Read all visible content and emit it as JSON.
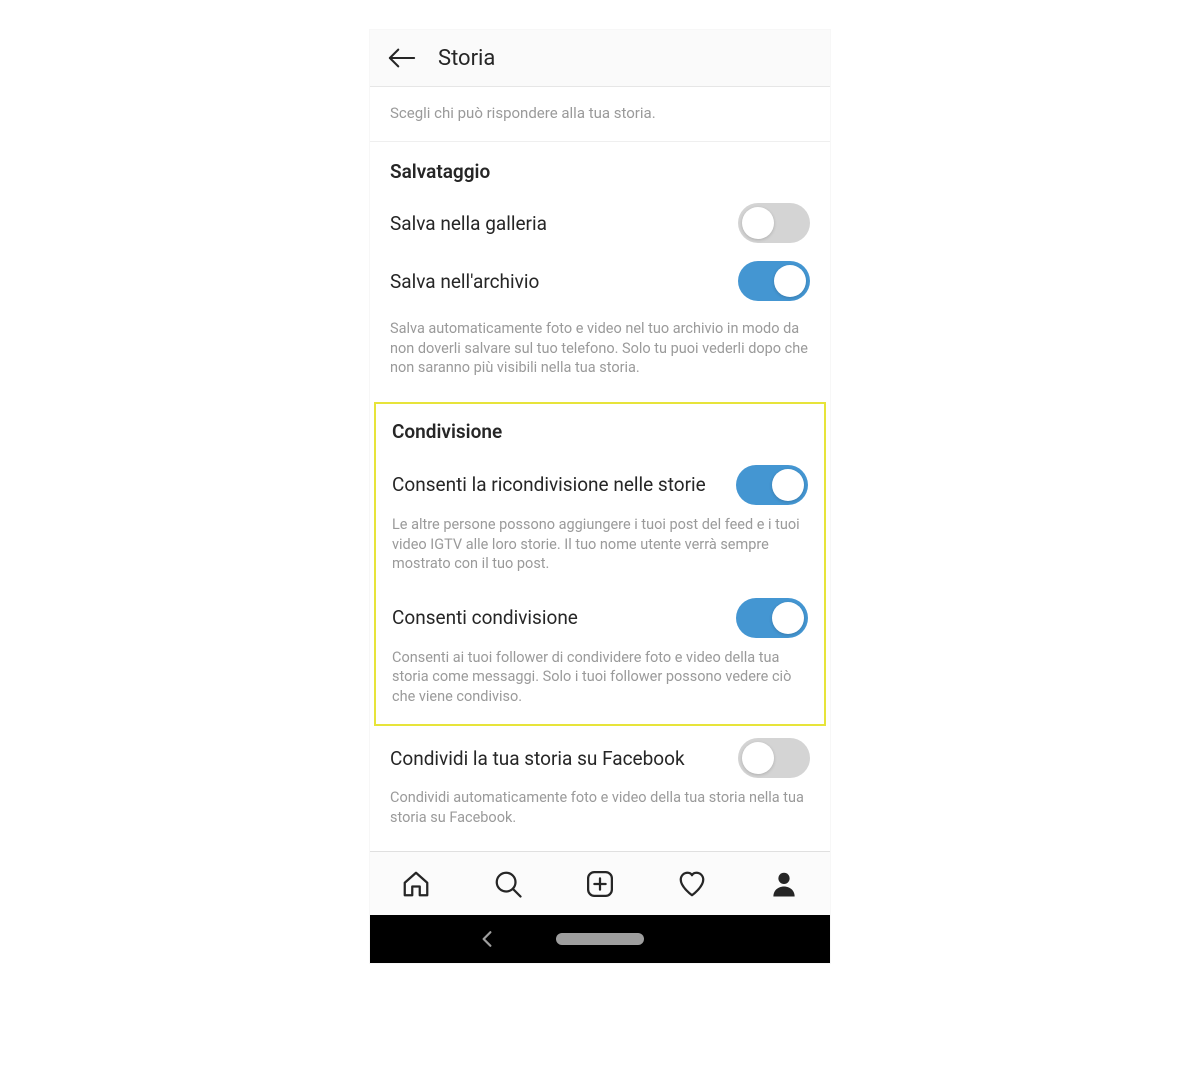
{
  "header": {
    "title": "Storia"
  },
  "reply_note": "Scegli chi può rispondere alla tua storia.",
  "saving": {
    "title": "Salvataggio",
    "gallery": {
      "label": "Salva nella galleria",
      "on": false
    },
    "archive": {
      "label": "Salva nell'archivio",
      "on": true
    },
    "help": "Salva automaticamente foto e video nel tuo archivio in modo da non doverli salvare sul tuo telefono. Solo tu puoi vederli dopo che non saranno più visibili nella tua storia."
  },
  "sharing": {
    "title": "Condivisione",
    "reshare": {
      "label": "Consenti la ricondivisione nelle storie",
      "on": true,
      "help": "Le altre persone possono aggiungere i tuoi post del feed e i tuoi video IGTV alle loro storie. Il tuo nome utente verrà sempre mostrato con il tuo post."
    },
    "allow": {
      "label": "Consenti condivisione",
      "on": true,
      "help": "Consenti ai tuoi follower di condividere foto e video della tua storia come messaggi. Solo i tuoi follower possono vedere ciò che viene condiviso."
    }
  },
  "facebook": {
    "label": "Condividi la tua storia su Facebook",
    "on": false,
    "help": "Condividi automaticamente foto e video della tua storia nella tua storia su Facebook."
  }
}
